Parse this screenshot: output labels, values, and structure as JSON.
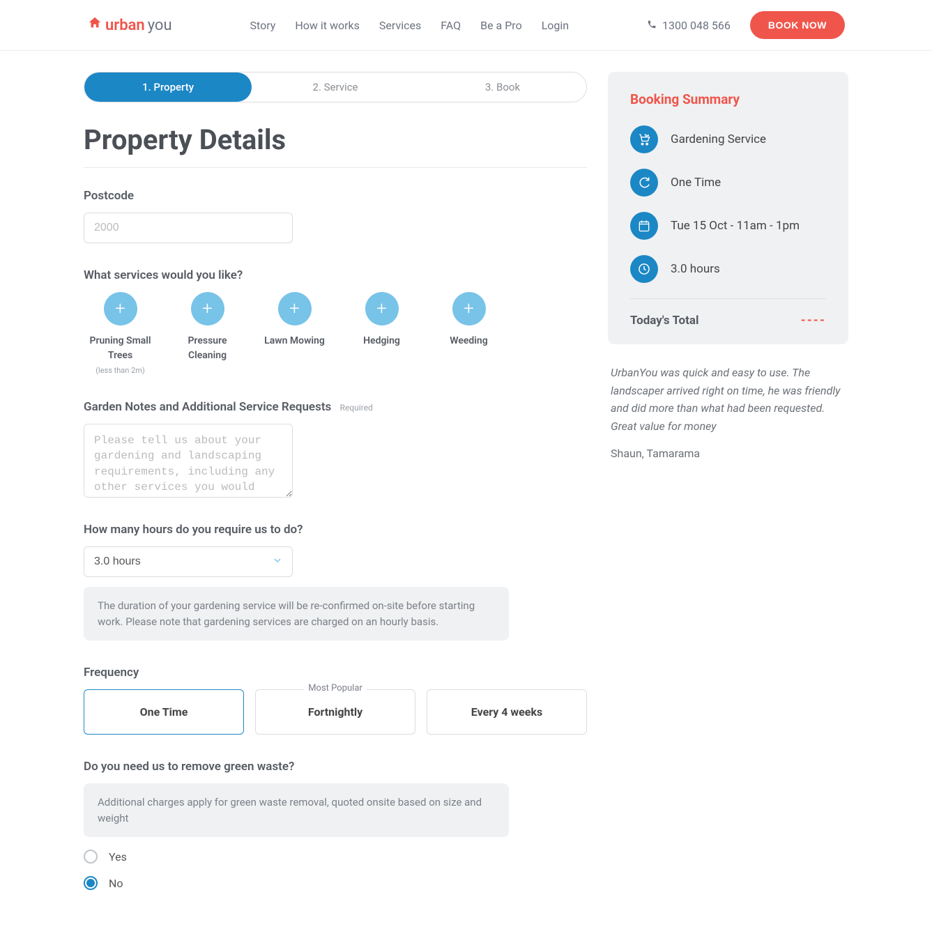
{
  "brand": {
    "urban": "urban",
    "you": "you"
  },
  "nav": {
    "story": "Story",
    "how": "How it works",
    "services": "Services",
    "faq": "FAQ",
    "bepro": "Be a Pro",
    "login": "Login"
  },
  "phone": "1300 048 566",
  "book_now": "BOOK NOW",
  "steps": {
    "s1": "1. Property",
    "s2": "2. Service",
    "s3": "3. Book"
  },
  "page_title": "Property Details",
  "postcode": {
    "label": "Postcode",
    "placeholder": "2000",
    "value": ""
  },
  "services_q": "What services would you like?",
  "services": [
    {
      "name": "Pruning Small Trees",
      "sub": "(less than 2m)"
    },
    {
      "name": "Pressure Cleaning",
      "sub": ""
    },
    {
      "name": "Lawn Mowing",
      "sub": ""
    },
    {
      "name": "Hedging",
      "sub": ""
    },
    {
      "name": "Weeding",
      "sub": ""
    }
  ],
  "notes": {
    "label": "Garden Notes and Additional Service Requests",
    "required": "Required",
    "placeholder": "Please tell us about your gardening and landscaping requirements, including any other services you would like (ie mulching, planting small plants)"
  },
  "hours": {
    "label": "How many hours do you require us to do?",
    "value": "3.0 hours",
    "info": "The duration of your gardening service will be re-confirmed on-site before starting work. Please note that gardening services are charged on an hourly basis."
  },
  "frequency": {
    "label": "Frequency",
    "badge": "Most Popular",
    "options": [
      "One Time",
      "Fortnightly",
      "Every 4 weeks"
    ],
    "selected": 0
  },
  "greenwaste": {
    "label": "Do you need us to remove green waste?",
    "info": "Additional charges apply for green waste removal, quoted onsite based on size and weight",
    "yes": "Yes",
    "no": "No",
    "selected": "no"
  },
  "summary": {
    "title": "Booking Summary",
    "service": "Gardening Service",
    "freq": "One Time",
    "date": "Tue 15 Oct - 11am - 1pm",
    "duration": "3.0 hours",
    "total_label": "Today's Total",
    "total_value": "----"
  },
  "testimonial": {
    "quote": "UrbanYou was quick and easy to use. The landscaper arrived right on time, he was friendly and did more than what had been requested. Great value for money",
    "author": "Shaun, Tamarama"
  }
}
